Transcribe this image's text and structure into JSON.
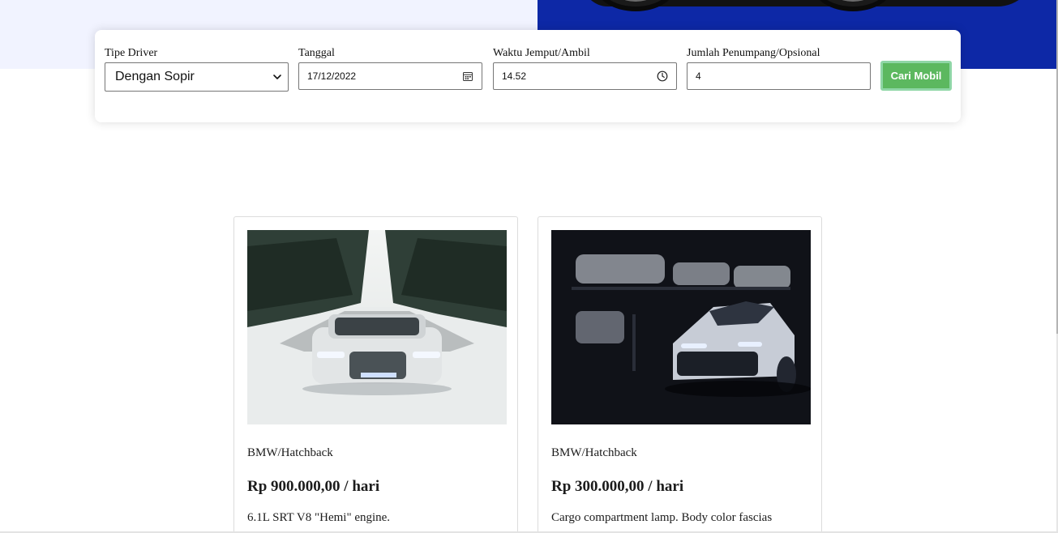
{
  "search": {
    "driver_type": {
      "label": "Tipe Driver",
      "value": "Dengan Sopir"
    },
    "date": {
      "label": "Tanggal",
      "value": "17/12/2022"
    },
    "pickup_time": {
      "label": "Waktu Jemput/Ambil",
      "value": "14.52"
    },
    "passengers": {
      "label": "Jumlah Penumpang/Opsional",
      "value": "4"
    },
    "submit_label": "Cari Mobil"
  },
  "cars": [
    {
      "name": "BMW/Hatchback",
      "price": "Rp 900.000,00 / hari",
      "description": "6.1L SRT V8 \"Hemi\" engine."
    },
    {
      "name": "BMW/Hatchback",
      "price": "Rp 300.000,00 / hari",
      "description": "Cargo compartment lamp. Body color fascias"
    }
  ],
  "colors": {
    "hero_blue": "#0d28a6",
    "hero_light": "#f1f3ff",
    "button_green": "#5cb85f"
  }
}
